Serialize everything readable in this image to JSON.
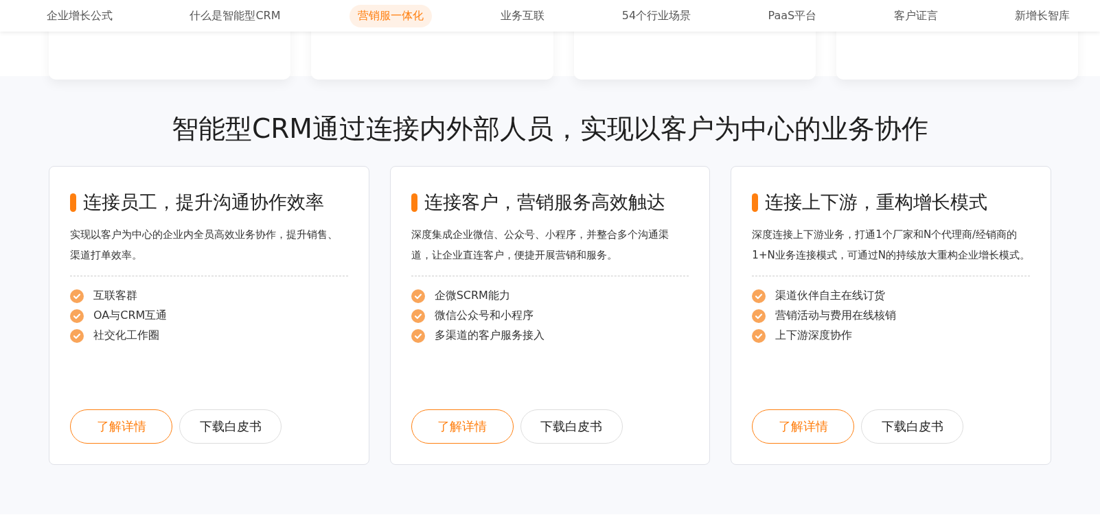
{
  "nav": {
    "items": [
      {
        "label": "企业增长公式",
        "selected": false
      },
      {
        "label": "什么是智能型CRM",
        "selected": false
      },
      {
        "label": "营销服一体化",
        "selected": true
      },
      {
        "label": "业务互联",
        "selected": false
      },
      {
        "label": "54个行业场景",
        "selected": false
      },
      {
        "label": "PaaS平台",
        "selected": false
      },
      {
        "label": "客户证言",
        "selected": false
      },
      {
        "label": "新增长智库",
        "selected": false
      }
    ]
  },
  "section": {
    "title": "智能型CRM通过连接内外部人员，实现以客户为中心的业务协作",
    "cards": [
      {
        "title": "连接员工，提升沟通协作效率",
        "description": "实现以客户为中心的企业内全员高效业务协作，提升销售、渠道打单效率。",
        "features": [
          "互联客群",
          "OA与CRM互通",
          "社交化工作圈"
        ],
        "buttons": [
          {
            "label": "了解详情",
            "kind": "primary"
          },
          {
            "label": "下载白皮书",
            "kind": "secondary"
          }
        ]
      },
      {
        "title": "连接客户，营销服务高效触达",
        "description": "深度集成企业微信、公众号、小程序，并整合多个沟通渠道，让企业直连客户，便捷开展营销和服务。",
        "features": [
          "企微SCRM能力",
          "微信公众号和小程序",
          "多渠道的客户服务接入"
        ],
        "buttons": [
          {
            "label": "了解详情",
            "kind": "primary"
          },
          {
            "label": "下载白皮书",
            "kind": "secondary"
          }
        ]
      },
      {
        "title": "连接上下游，重构增长模式",
        "description": "深度连接上下游业务，打通1个厂家和N个代理商/经销商的1+N业务连接模式，可通过N的持续放大重构企业增长模式。",
        "features": [
          "渠道伙伴自主在线订货",
          "营销活动与费用在线核销",
          "上下游深度协作"
        ],
        "buttons": [
          {
            "label": "了解详情",
            "kind": "primary"
          },
          {
            "label": "下载白皮书",
            "kind": "secondary"
          }
        ]
      }
    ]
  }
}
